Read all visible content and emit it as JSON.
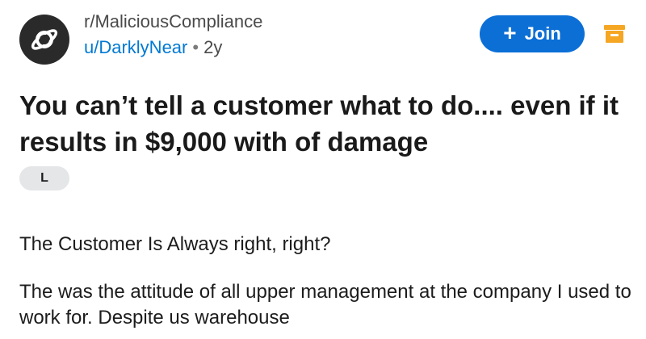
{
  "post": {
    "subreddit": "r/MaliciousCompliance",
    "author": "u/DarklyNear",
    "separator": "•",
    "age": "2y",
    "join_label": "Join",
    "title": "You can’t tell a customer what to do.... even if it results in $9,000 with of damage",
    "flair": "L",
    "body": [
      "The Customer Is Always right, right?",
      "The was the attitude of all upper management at the company I used to work for. Despite us warehouse"
    ]
  },
  "colors": {
    "accent": "#0b6fd6",
    "username": "#0079d3",
    "save_icon": "#f5a623"
  },
  "icons": {
    "avatar": "planet-icon",
    "join": "plus-icon",
    "save": "save-icon"
  }
}
